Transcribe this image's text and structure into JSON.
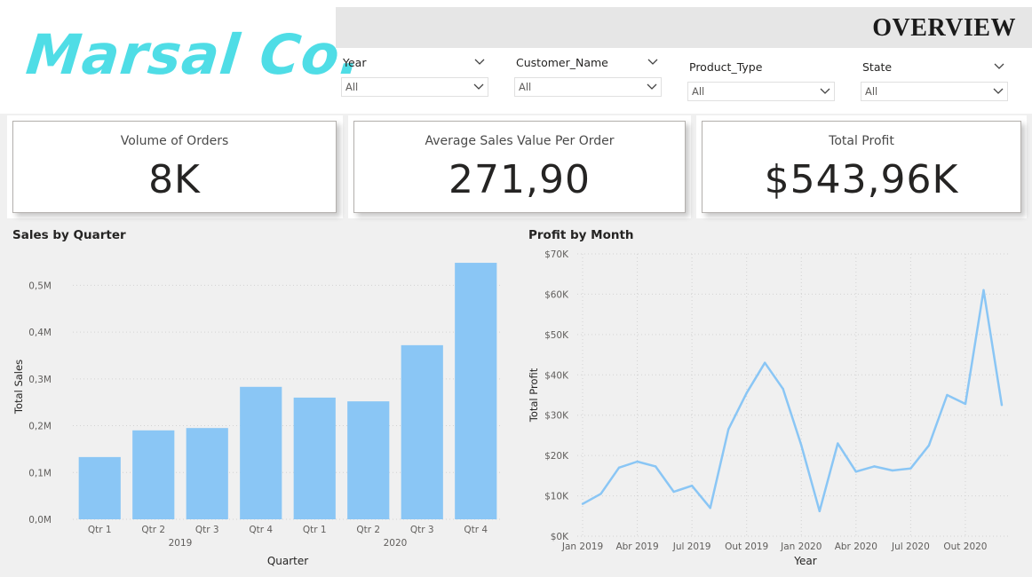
{
  "logo": {
    "text": "Marsal Co.",
    "color": "#4fdde6"
  },
  "header": {
    "title": "OVERVIEW"
  },
  "filters": [
    {
      "label": "Year",
      "value": "All"
    },
    {
      "label": "Customer_Name",
      "value": "All"
    },
    {
      "label": "Product_Type",
      "value": "All"
    },
    {
      "label": "State",
      "value": "All"
    }
  ],
  "kpis": [
    {
      "label": "Volume of Orders",
      "value": "8K"
    },
    {
      "label": "Average Sales Value Per Order",
      "value": "271,90"
    },
    {
      "label": "Total Profit",
      "value": "$543,96K"
    }
  ],
  "colors": {
    "accent": "#8ac6f5",
    "gridline": "#d2d2d2"
  },
  "chart_data": [
    {
      "type": "bar",
      "title": "Sales by Quarter",
      "xlabel": "Quarter",
      "ylabel": "Total Sales",
      "categories": [
        "Qtr 1",
        "Qtr 2",
        "Qtr 3",
        "Qtr 4",
        "Qtr 1",
        "Qtr 2",
        "Qtr 3",
        "Qtr 4"
      ],
      "groups": [
        {
          "label": "2019",
          "span": [
            0,
            3
          ]
        },
        {
          "label": "2020",
          "span": [
            4,
            7
          ]
        }
      ],
      "values": [
        0.133,
        0.19,
        0.195,
        0.283,
        0.26,
        0.252,
        0.372,
        0.548
      ],
      "ylim": [
        0,
        0.55
      ],
      "yticks": [
        0,
        0.1,
        0.2,
        0.3,
        0.4,
        0.5
      ],
      "ytick_labels": [
        "0,0M",
        "0,1M",
        "0,2M",
        "0,3M",
        "0,4M",
        "0,5M"
      ],
      "grid": true
    },
    {
      "type": "line",
      "title": "Profit by Month",
      "xlabel": "Year",
      "ylabel": "Total Profit",
      "x": [
        "Jan 2019",
        "Feb 2019",
        "Mar 2019",
        "Abr 2019",
        "May 2019",
        "Jun 2019",
        "Jul 2019",
        "Aug 2019",
        "Sep 2019",
        "Out 2019",
        "Nov 2019",
        "Dec 2019",
        "Jan 2020",
        "Feb 2020",
        "Mar 2020",
        "Abr 2020",
        "May 2020",
        "Jun 2020",
        "Jul 2020",
        "Aug 2020",
        "Sep 2020",
        "Out 2020",
        "Nov 2020",
        "Dec 2020"
      ],
      "values": [
        8000,
        10500,
        17000,
        18500,
        17300,
        11000,
        12500,
        7000,
        26500,
        35500,
        43000,
        36500,
        22500,
        6200,
        23000,
        16000,
        17300,
        16300,
        16800,
        22500,
        35000,
        32800,
        61000,
        32500
      ],
      "ylim": [
        0,
        70000
      ],
      "yticks": [
        0,
        10000,
        20000,
        30000,
        40000,
        50000,
        60000,
        70000
      ],
      "ytick_labels": [
        "$0K",
        "$10K",
        "$20K",
        "$30K",
        "$40K",
        "$50K",
        "$60K",
        "$70K"
      ],
      "xtick_labels": [
        {
          "i": 0,
          "label": "Jan 2019"
        },
        {
          "i": 3,
          "label": "Abr 2019"
        },
        {
          "i": 6,
          "label": "Jul 2019"
        },
        {
          "i": 9,
          "label": "Out 2019"
        },
        {
          "i": 12,
          "label": "Jan 2020"
        },
        {
          "i": 15,
          "label": "Abr 2020"
        },
        {
          "i": 18,
          "label": "Jul 2020"
        },
        {
          "i": 21,
          "label": "Out 2020"
        }
      ],
      "grid": true
    }
  ]
}
